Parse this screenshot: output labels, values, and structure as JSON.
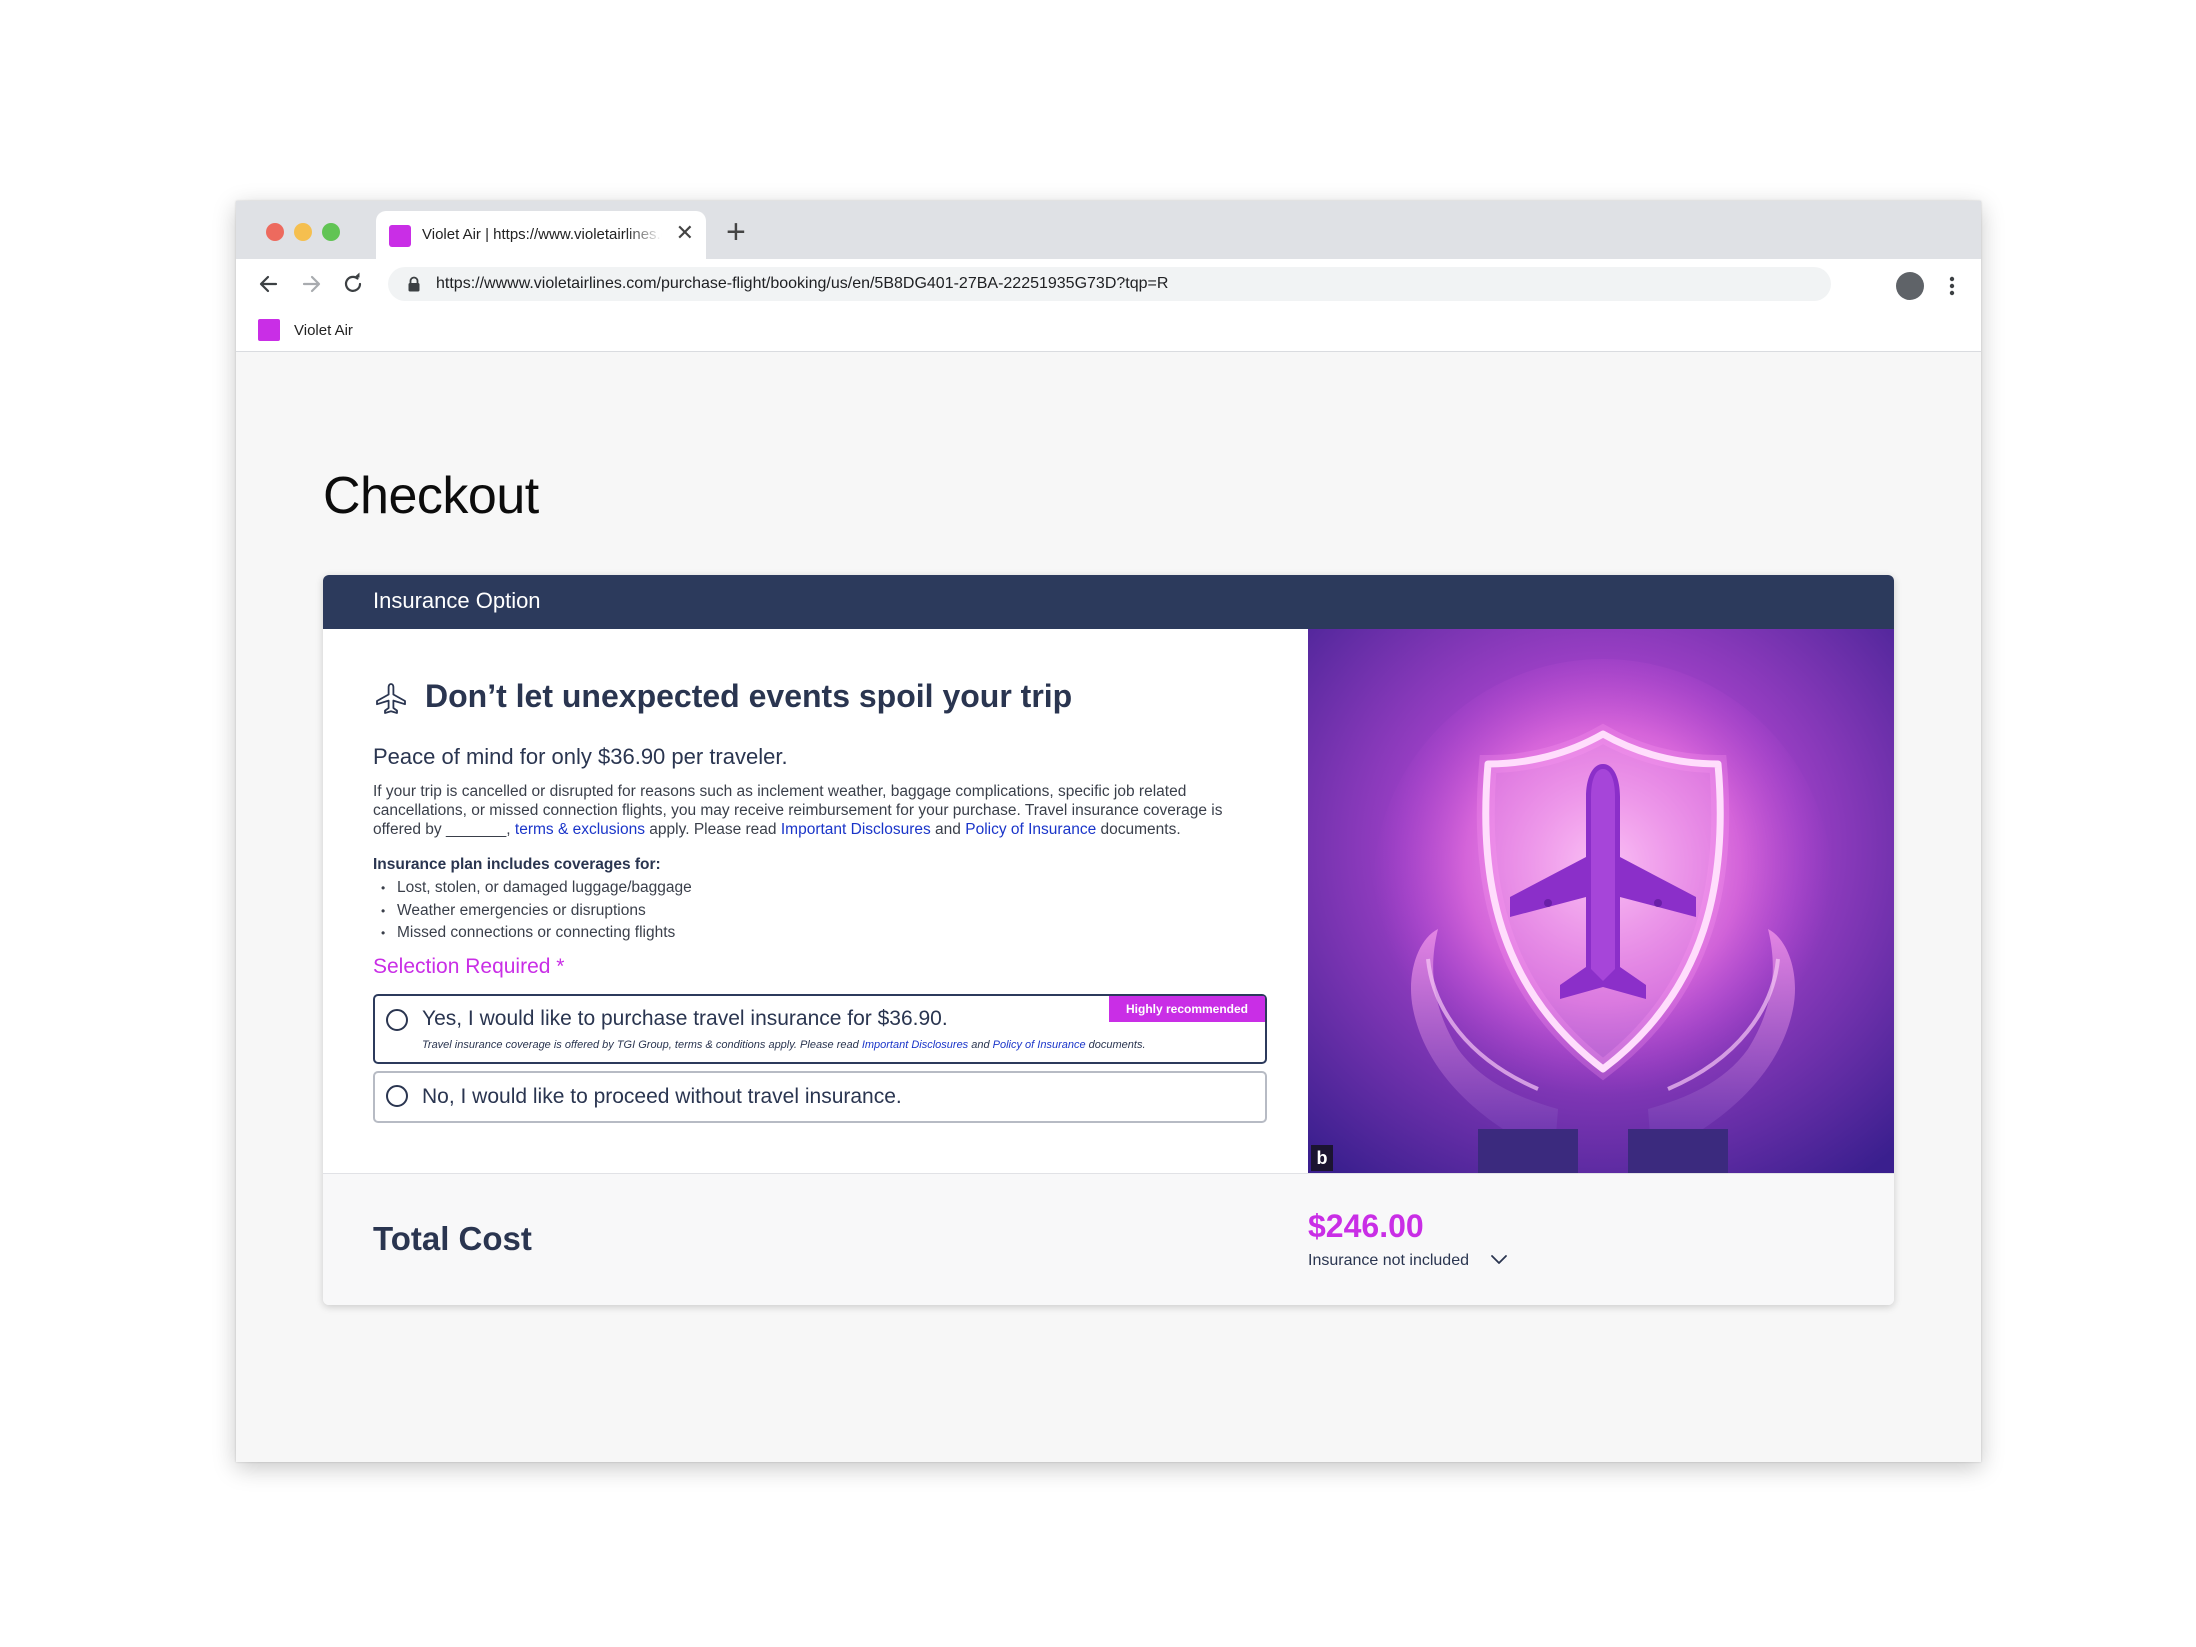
{
  "browser": {
    "tab_title": "Violet Air | https://www.violetairlines.com",
    "tab_close": "✕",
    "new_tab": "+",
    "url": "https://wwww.violetairlines.com/purchase-flight/booking/us/en/5B8DG401-27BA-22251935G73D?tqp=R",
    "bookmark_label": "Violet Air",
    "favicon_color": "#c92ee6"
  },
  "page": {
    "title": "Checkout"
  },
  "insurance": {
    "header_title": "Insurance Option",
    "headline": "Don’t let unexpected events spoil your trip",
    "subhead": "Peace of mind for only $36.90 per traveler.",
    "body_part1": "If your trip is cancelled or disrupted for reasons such as inclement weather, baggage complications, specific job related cancellations, or missed connection flights, you may receive reimbursement for your purchase. Travel insurance coverage is offered by _______, ",
    "link_terms": "terms & exclusions",
    "body_part2": " apply. Please read ",
    "link_disclosures": "Important Disclosures",
    "body_and": " and ",
    "link_policy": "Policy of Insurance",
    "body_part3": " documents.",
    "plan_title": "Insurance plan includes coverages for:",
    "plan_items": [
      "Lost, stolen, or damaged luggage/baggage",
      "Weather emergencies or disruptions",
      "Missed connections or connecting flights"
    ],
    "selection_required": "Selection Required *",
    "option_yes_label": "Yes, I would like to purchase travel insurance for $36.90.",
    "option_yes_badge": "Highly recommended",
    "option_yes_fine_1": "Travel insurance coverage is offered by TGI Group, terms & conditions apply. Please read ",
    "option_yes_fine_link1": "Important Disclosures",
    "option_yes_fine_and": " and ",
    "option_yes_fine_link2": "Policy of Insurance",
    "option_yes_fine_2": " documents.",
    "option_no_label": "No, I would like to proceed without travel insurance.",
    "image_mark": "b"
  },
  "total": {
    "label": "Total Cost",
    "price": "$246.00",
    "note": "Insurance not included"
  },
  "colors": {
    "accent": "#c92ee6",
    "header_navy": "#2c3a5c",
    "link_blue": "#1a35c9"
  },
  "icons": {
    "back": "arrow-left-icon",
    "forward": "arrow-right-icon",
    "reload": "reload-icon",
    "lock": "lock-icon",
    "menu": "kebab-menu-icon",
    "plane": "airplane-icon",
    "chevron": "chevron-down-icon"
  }
}
